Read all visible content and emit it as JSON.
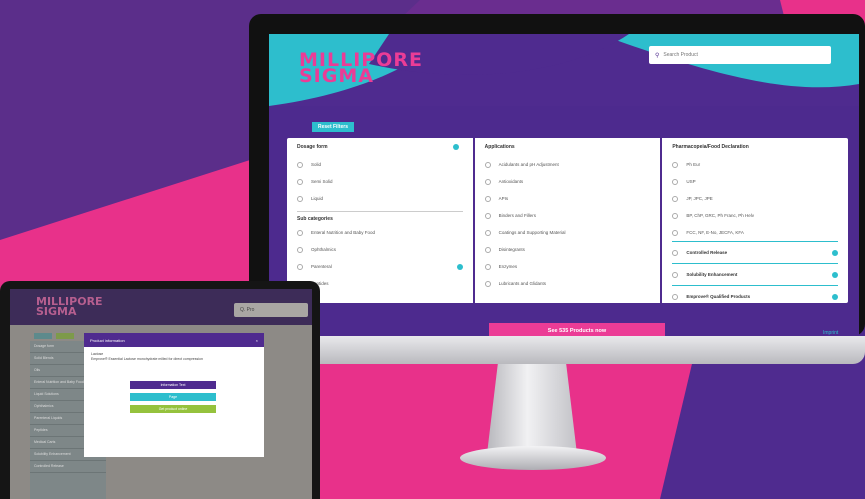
{
  "monitor": {
    "logo": [
      "MILLIPORE",
      "SIGMA"
    ],
    "search": {
      "placeholder": "Search Product"
    },
    "reset_label": "Reset Filters",
    "columns": [
      {
        "title": "Dosage form",
        "options": [
          "Solid",
          "Semi Solid",
          "Liquid"
        ],
        "sub_title": "Sub categories",
        "sub_options": [
          "Enteral Nutrition and Baby Food",
          "Ophthalmics",
          "Parenteral",
          "Peptides"
        ]
      },
      {
        "title": "Applications",
        "options": [
          "Acidulants and pH Adjustment",
          "Antioxidants",
          "APIs",
          "Binders and Fillers",
          "Coatings and Supporting Material",
          "Disintegrants",
          "Enzymes",
          "Lubricants and Glidants"
        ]
      },
      {
        "title": "Pharmacopeia/Food Declaration",
        "options": [
          "Ph Eur",
          "USP",
          "JP, JPC, JPE",
          "BP, ChP, GRC, Ph Franc, Ph Helv",
          "FCC, NF, E-No, JECFA, KFA"
        ],
        "toggles": [
          "Controlled Release",
          "Solubility Enhancement",
          "Emprove® Qualified Products"
        ]
      }
    ],
    "see_products_label": "See 535 Products now",
    "imprint_label": "Imprint"
  },
  "tablet": {
    "logo": [
      "MILLIPORE",
      "SIGMA"
    ],
    "search_text": "Q. Pro",
    "sidebar_items": [
      "Dosage form",
      "Solid Blends",
      "Oils",
      "Enteral Nutrition and Baby Food",
      "Liquid Solutions",
      "Ophthalmics",
      "Parenteral Liquids",
      "Peptides",
      "Medical Carts",
      "Solubility Enhancement",
      "Controlled Release"
    ],
    "modal": {
      "title": "Product information",
      "close": "×",
      "body_label": "Lactose",
      "body_text": "Emprove® Essential Lactose monohydrate milled for direct compression",
      "buttons": [
        "Information Text",
        "Page",
        "Get product online"
      ]
    }
  },
  "colors": {
    "purple": "#4f2b8f",
    "magenta": "#eb3c96",
    "teal": "#2dbecd",
    "background": "#e8318a"
  }
}
